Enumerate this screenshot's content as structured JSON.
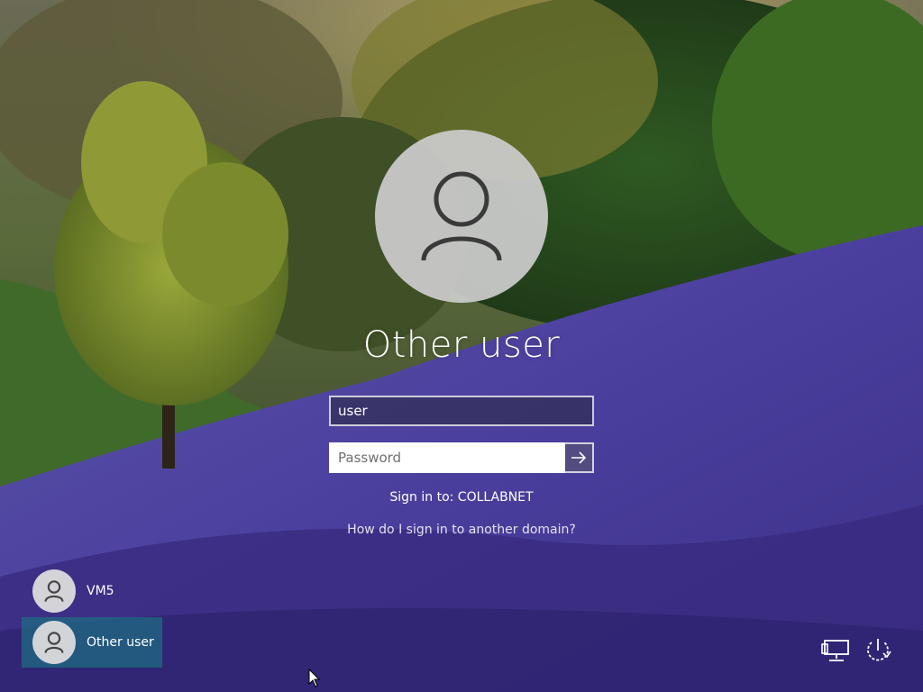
{
  "login": {
    "display_name": "Other user",
    "username_value": "user",
    "password_placeholder": "Password",
    "sign_in_to": "Sign in to: COLLABNET",
    "other_domain_link": "How do I sign in to another domain?"
  },
  "user_list": {
    "items": [
      {
        "label": "VM5",
        "selected": false
      },
      {
        "label": "Other user",
        "selected": true
      }
    ]
  },
  "icons": {
    "avatar": "person-icon",
    "submit": "arrow-right-icon",
    "network": "network-icon",
    "power": "power-icon",
    "cursor": "mouse-pointer-icon"
  },
  "colors": {
    "selected_tile": "#1e6e82",
    "avatar_bg": "#cdcdcd",
    "text": "#ffffff"
  }
}
